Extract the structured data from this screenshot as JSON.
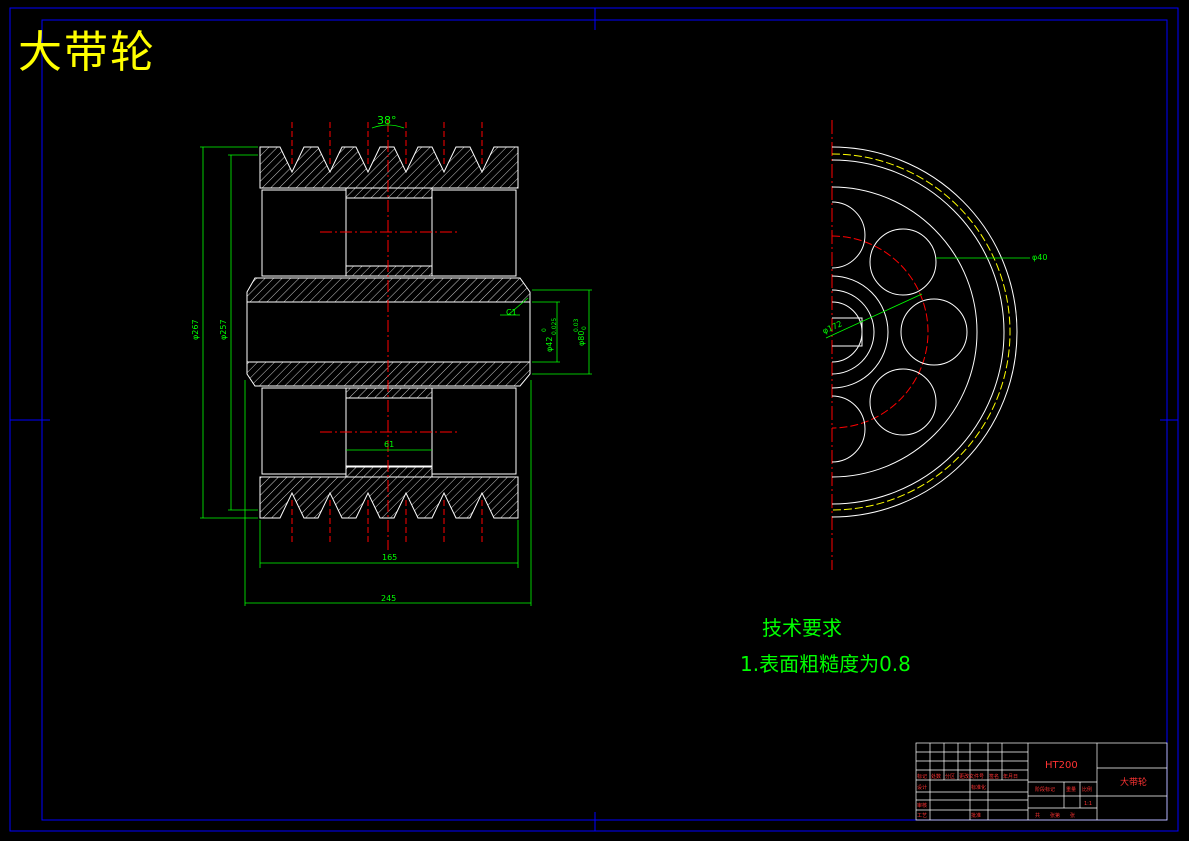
{
  "drawing_title": "大带轮",
  "technical_requirements": {
    "heading": "技术要求",
    "item1": "1.表面粗糙度为0.8"
  },
  "dimensions": {
    "groove_angle": "38°",
    "dia_outer": "φ267",
    "dia_root": "φ257",
    "dia_bore": "φ42",
    "bore_tol_upper": "0.025",
    "bore_tol_lower": "0",
    "dia_hub": "φ80",
    "hub_tol_upper": "0.03",
    "hub_tol_lower": "0",
    "chamfer": "C1",
    "web_width": "61",
    "rim_width": "165",
    "total_width": "245",
    "dia_hole": "φ40",
    "dia_pcd": "φ172"
  },
  "title_block": {
    "material": "HT200",
    "part_name": "大带轮",
    "labels": [
      "标记",
      "处数",
      "分区",
      "更改文件号",
      "签名",
      "年月日",
      "设计",
      "标准化",
      "审核",
      "工艺",
      "批准",
      "阶段标记",
      "重量",
      "比例",
      "共",
      "张第",
      "张"
    ],
    "scale": "1:1"
  },
  "colors": {
    "background": "#000000",
    "border": "#0000ff",
    "outline": "#ffffff",
    "dimension": "#00ff00",
    "centerline": "#ff0000",
    "title": "#ffff00",
    "titleblock_text": "#ff3333"
  }
}
